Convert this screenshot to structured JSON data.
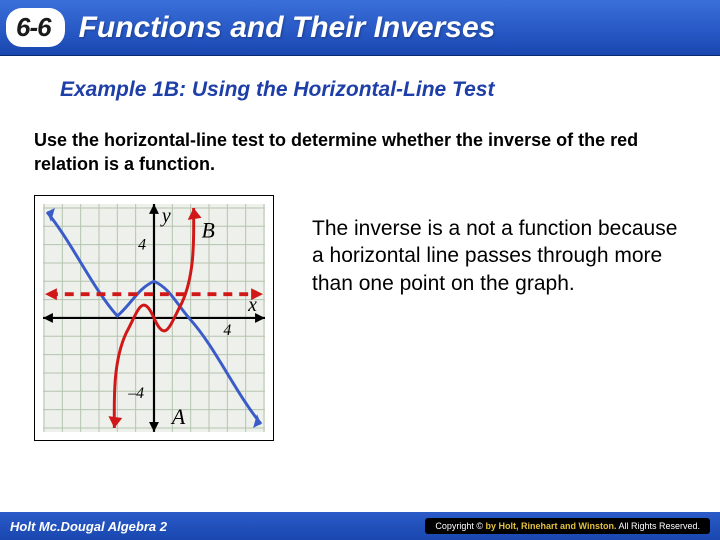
{
  "header": {
    "section_number": "6-6",
    "title": "Functions and Their Inverses"
  },
  "example_title": "Example 1B: Using the Horizontal-Line Test",
  "instruction": "Use the horizontal-line test to determine whether the inverse of the red relation is a function.",
  "explanation": "The inverse is a not a function because a horizontal line passes through more than one point on the graph.",
  "graph": {
    "x_axis_label": "x",
    "y_axis_label": "y",
    "tick_x": "4",
    "tick_y_pos": "4",
    "tick_y_neg": "–4",
    "curve_a_label": "A",
    "curve_b_label": "B"
  },
  "footer": {
    "book": "Holt Mc.Dougal Algebra 2",
    "copyright_prefix": "Copyright © ",
    "copyright_brand": "by Holt, Rinehart and Winston.",
    "copyright_suffix": " All Rights Reserved."
  },
  "chart_data": {
    "type": "line",
    "title": "",
    "xlabel": "x",
    "ylabel": "y",
    "xlim": [
      -6,
      6
    ],
    "ylim": [
      -6,
      6
    ],
    "grid": true,
    "series": [
      {
        "name": "A",
        "color": "#3a5cc8",
        "x": [
          -6,
          -5,
          -4,
          -3,
          -2,
          -1,
          -0.5,
          0,
          0.5,
          1,
          2,
          3,
          4,
          5,
          6
        ],
        "y": [
          6,
          4.5,
          2.8,
          1,
          0,
          1,
          1.5,
          2,
          1.5,
          1,
          0,
          -1,
          -2.8,
          -4.5,
          -6
        ]
      },
      {
        "name": "B",
        "color": "#d01818",
        "x": [
          -2.2,
          -2,
          -1.5,
          -1,
          -0.5,
          0,
          0.5,
          1,
          1.5,
          2,
          2.2
        ],
        "y": [
          -6,
          -4,
          0.5,
          2,
          1.3,
          0,
          -1.3,
          -2,
          -0.5,
          4,
          6
        ]
      }
    ],
    "annotations": [
      {
        "type": "hline",
        "y": 1.3,
        "style": "dashed",
        "color": "#d01818"
      }
    ]
  }
}
